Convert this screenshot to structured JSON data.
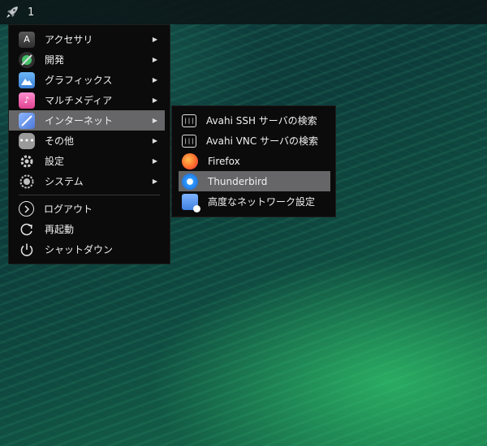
{
  "taskbar": {
    "workspace_label": "1",
    "launcher_icon": "rocket-icon"
  },
  "main_menu": {
    "items": [
      {
        "label": "アクセサリ",
        "icon": "accessories-icon",
        "submenu": true
      },
      {
        "label": "開発",
        "icon": "development-icon",
        "submenu": true
      },
      {
        "label": "グラフィックス",
        "icon": "graphics-icon",
        "submenu": true
      },
      {
        "label": "マルチメディア",
        "icon": "multimedia-icon",
        "submenu": true
      },
      {
        "label": "インターネット",
        "icon": "internet-icon",
        "submenu": true,
        "active": true
      },
      {
        "label": "その他",
        "icon": "other-icon",
        "submenu": true
      },
      {
        "label": "設定",
        "icon": "settings-icon",
        "submenu": true
      },
      {
        "label": "システム",
        "icon": "system-icon",
        "submenu": true
      }
    ],
    "session": [
      {
        "label": "ログアウト",
        "icon": "logout-icon"
      },
      {
        "label": "再起動",
        "icon": "reboot-icon"
      },
      {
        "label": "シャットダウン",
        "icon": "shutdown-icon"
      }
    ],
    "submenu_arrow": "▶"
  },
  "internet_submenu": {
    "items": [
      {
        "label": "Avahi SSH サーバの検索",
        "icon": "avahi-ssh-icon"
      },
      {
        "label": "Avahi VNC サーバの検索",
        "icon": "avahi-vnc-icon"
      },
      {
        "label": "Firefox",
        "icon": "firefox-icon"
      },
      {
        "label": "Thunderbird",
        "icon": "thunderbird-icon",
        "active": true
      },
      {
        "label": "高度なネットワーク設定",
        "icon": "network-settings-icon"
      }
    ]
  },
  "colors": {
    "menu_bg": "#0b0b0b",
    "highlight": "#666668",
    "text": "#f0f0f0"
  }
}
